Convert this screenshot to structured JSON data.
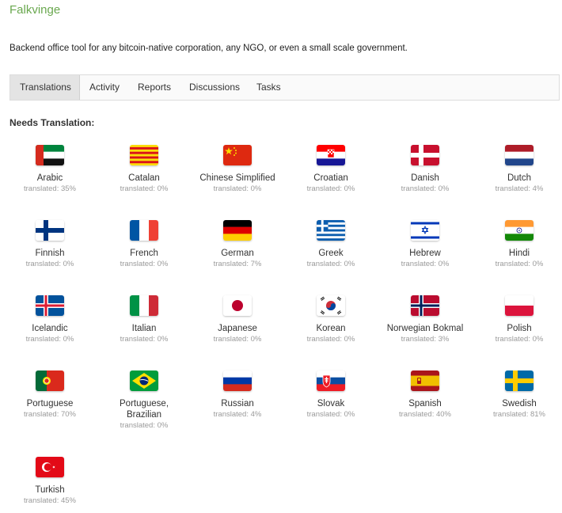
{
  "header": {
    "title": "Falkvinge",
    "subtitle": "Backend office tool for any bitcoin-native corporation, any NGO, or even a small scale government."
  },
  "tabs": [
    {
      "label": "Translations",
      "active": true
    },
    {
      "label": "Activity"
    },
    {
      "label": "Reports"
    },
    {
      "label": "Discussions"
    },
    {
      "label": "Tasks"
    }
  ],
  "section": {
    "label": "Needs Translation:"
  },
  "languages": [
    {
      "name": "Arabic",
      "status": "translated: 35%",
      "flag": "arabic-flag-icon"
    },
    {
      "name": "Catalan",
      "status": "translated: 0%",
      "flag": "catalan-flag-icon"
    },
    {
      "name": "Chinese Simplified",
      "status": "translated: 0%",
      "flag": "china-flag-icon"
    },
    {
      "name": "Croatian",
      "status": "translated: 0%",
      "flag": "croatia-flag-icon"
    },
    {
      "name": "Danish",
      "status": "translated: 0%",
      "flag": "denmark-flag-icon"
    },
    {
      "name": "Dutch",
      "status": "translated: 4%",
      "flag": "netherlands-flag-icon"
    },
    {
      "name": "Finnish",
      "status": "translated: 0%",
      "flag": "finland-flag-icon"
    },
    {
      "name": "French",
      "status": "translated: 0%",
      "flag": "france-flag-icon"
    },
    {
      "name": "German",
      "status": "translated: 7%",
      "flag": "germany-flag-icon"
    },
    {
      "name": "Greek",
      "status": "translated: 0%",
      "flag": "greece-flag-icon"
    },
    {
      "name": "Hebrew",
      "status": "translated: 0%",
      "flag": "israel-flag-icon"
    },
    {
      "name": "Hindi",
      "status": "translated: 0%",
      "flag": "india-flag-icon"
    },
    {
      "name": "Icelandic",
      "status": "translated: 0%",
      "flag": "iceland-flag-icon"
    },
    {
      "name": "Italian",
      "status": "translated: 0%",
      "flag": "italy-flag-icon"
    },
    {
      "name": "Japanese",
      "status": "translated: 0%",
      "flag": "japan-flag-icon"
    },
    {
      "name": "Korean",
      "status": "translated: 0%",
      "flag": "korea-flag-icon"
    },
    {
      "name": "Norwegian Bokmal",
      "status": "translated: 3%",
      "flag": "norway-flag-icon"
    },
    {
      "name": "Polish",
      "status": "translated: 0%",
      "flag": "poland-flag-icon"
    },
    {
      "name": "Portuguese",
      "status": "translated: 70%",
      "flag": "portugal-flag-icon"
    },
    {
      "name": "Portuguese, Brazilian",
      "status": "translated: 0%",
      "flag": "brazil-flag-icon"
    },
    {
      "name": "Russian",
      "status": "translated: 4%",
      "flag": "russia-flag-icon"
    },
    {
      "name": "Slovak",
      "status": "translated: 0%",
      "flag": "slovakia-flag-icon"
    },
    {
      "name": "Spanish",
      "status": "translated: 40%",
      "flag": "spain-flag-icon"
    },
    {
      "name": "Swedish",
      "status": "translated: 81%",
      "flag": "sweden-flag-icon"
    },
    {
      "name": "Turkish",
      "status": "translated: 45%",
      "flag": "turkey-flag-icon"
    }
  ],
  "colors": {
    "brand": "#6aa84f",
    "muted": "#9a9a9a"
  }
}
